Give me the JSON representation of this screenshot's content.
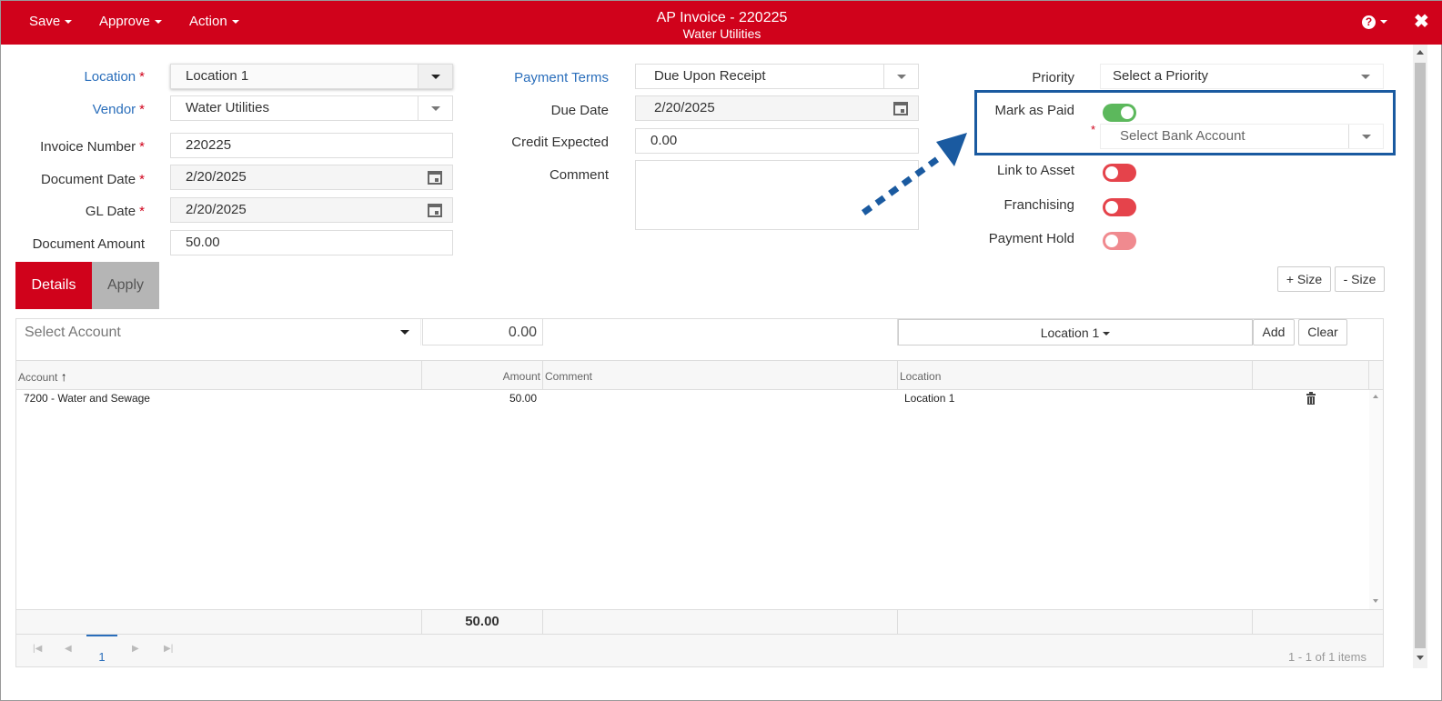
{
  "header": {
    "menus": [
      "Save",
      "Approve",
      "Action"
    ],
    "title": "AP Invoice - 220225",
    "subtitle": "Water Utilities",
    "help_icon": "question-circle-icon",
    "close_icon": "close-icon",
    "accent_color": "#d0021b"
  },
  "form_left": {
    "location": {
      "label": "Location",
      "value": "Location 1"
    },
    "vendor": {
      "label": "Vendor",
      "value": "Water Utilities"
    },
    "invoice_number": {
      "label": "Invoice Number",
      "value": "220225"
    },
    "document_date": {
      "label": "Document Date",
      "value": "2/20/2025"
    },
    "gl_date": {
      "label": "GL Date",
      "value": "2/20/2025"
    },
    "document_amount": {
      "label": "Document Amount",
      "value": "50.00"
    },
    "required_mark": "*"
  },
  "form_mid": {
    "payment_terms": {
      "label": "Payment Terms",
      "value": "Due Upon Receipt"
    },
    "due_date": {
      "label": "Due Date",
      "value": "2/20/2025"
    },
    "credit_expected": {
      "label": "Credit Expected",
      "value": "0.00"
    },
    "comment": {
      "label": "Comment",
      "value": ""
    }
  },
  "form_right": {
    "priority": {
      "label": "Priority",
      "placeholder": "Select a Priority"
    },
    "mark_as_paid": {
      "label": "Mark as Paid",
      "state": "on"
    },
    "bank_account": {
      "placeholder": "Select Bank Account",
      "required_mark": "*"
    },
    "link_to_asset": {
      "label": "Link to Asset",
      "state": "off"
    },
    "franchising": {
      "label": "Franchising",
      "state": "off"
    },
    "payment_hold": {
      "label": "Payment Hold",
      "state": "off"
    }
  },
  "tabs": [
    "Details",
    "Apply"
  ],
  "size_buttons": [
    "+ Size",
    "- Size"
  ],
  "grid": {
    "toolbar": {
      "account_placeholder": "Select Account",
      "amount": "0.00",
      "location": "Location 1",
      "add_label": "Add",
      "clear_label": "Clear"
    },
    "columns": [
      "Account",
      "Amount",
      "Comment",
      "Location"
    ],
    "rows": [
      {
        "account": "7200 - Water and Sewage",
        "amount": "50.00",
        "comment": "",
        "location": "Location 1"
      }
    ],
    "footer_total": "50.00",
    "pager": {
      "page": "1",
      "summary": "1 - 1 of 1 items"
    }
  },
  "annotation_color": "#1a5aa0"
}
